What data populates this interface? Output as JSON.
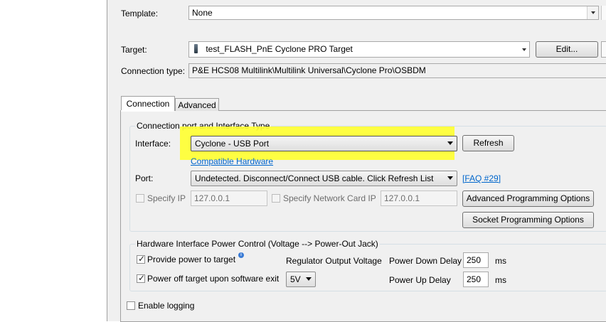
{
  "template": {
    "label": "Template:",
    "value": "None"
  },
  "target": {
    "label": "Target:",
    "value": "test_FLASH_PnE Cyclone PRO Target",
    "edit_label": "Edit..."
  },
  "connection_type": {
    "label": "Connection type:",
    "value": "P&E HCS08 Multilink\\Multilink Universal\\Cyclone Pro\\OSBDM"
  },
  "tabs": [
    {
      "label": "Connection"
    },
    {
      "label": "Advanced"
    }
  ],
  "connection_group": {
    "title": "Connection port and Interface Type",
    "interface_label": "Interface:",
    "interface_value": "Cyclone - USB Port",
    "refresh_label": "Refresh",
    "compatible_link": "Compatible Hardware",
    "port_label": "Port:",
    "port_value": "Undetected. Disconnect/Connect USB cable. Click Refresh List",
    "faq_link": "[FAQ #29]",
    "specify_ip_label": "Specify IP",
    "ip_value": "127.0.0.1",
    "specify_netcard_label": "Specify Network Card IP",
    "netcard_value": "127.0.0.1",
    "advanced_prog_label": "Advanced Programming Options",
    "socket_prog_label": "Socket Programming Options"
  },
  "power_group": {
    "title": "Hardware Interface Power Control (Voltage --> Power-Out Jack)",
    "provide_power_label": "Provide power to target",
    "provide_power_checked": true,
    "regulator_label": "Regulator Output Voltage",
    "power_down_label": "Power Down Delay",
    "power_down_value": "250",
    "power_down_unit": "ms",
    "power_off_label": "Power off target upon software exit",
    "power_off_checked": true,
    "voltage_value": "5V",
    "power_up_label": "Power Up Delay",
    "power_up_value": "250",
    "power_up_unit": "ms"
  },
  "logging": {
    "label": "Enable logging",
    "checked": false
  },
  "colors": {
    "link": "#0066cc",
    "highlight": "#ffff33",
    "panel": "#f0f0f0"
  }
}
